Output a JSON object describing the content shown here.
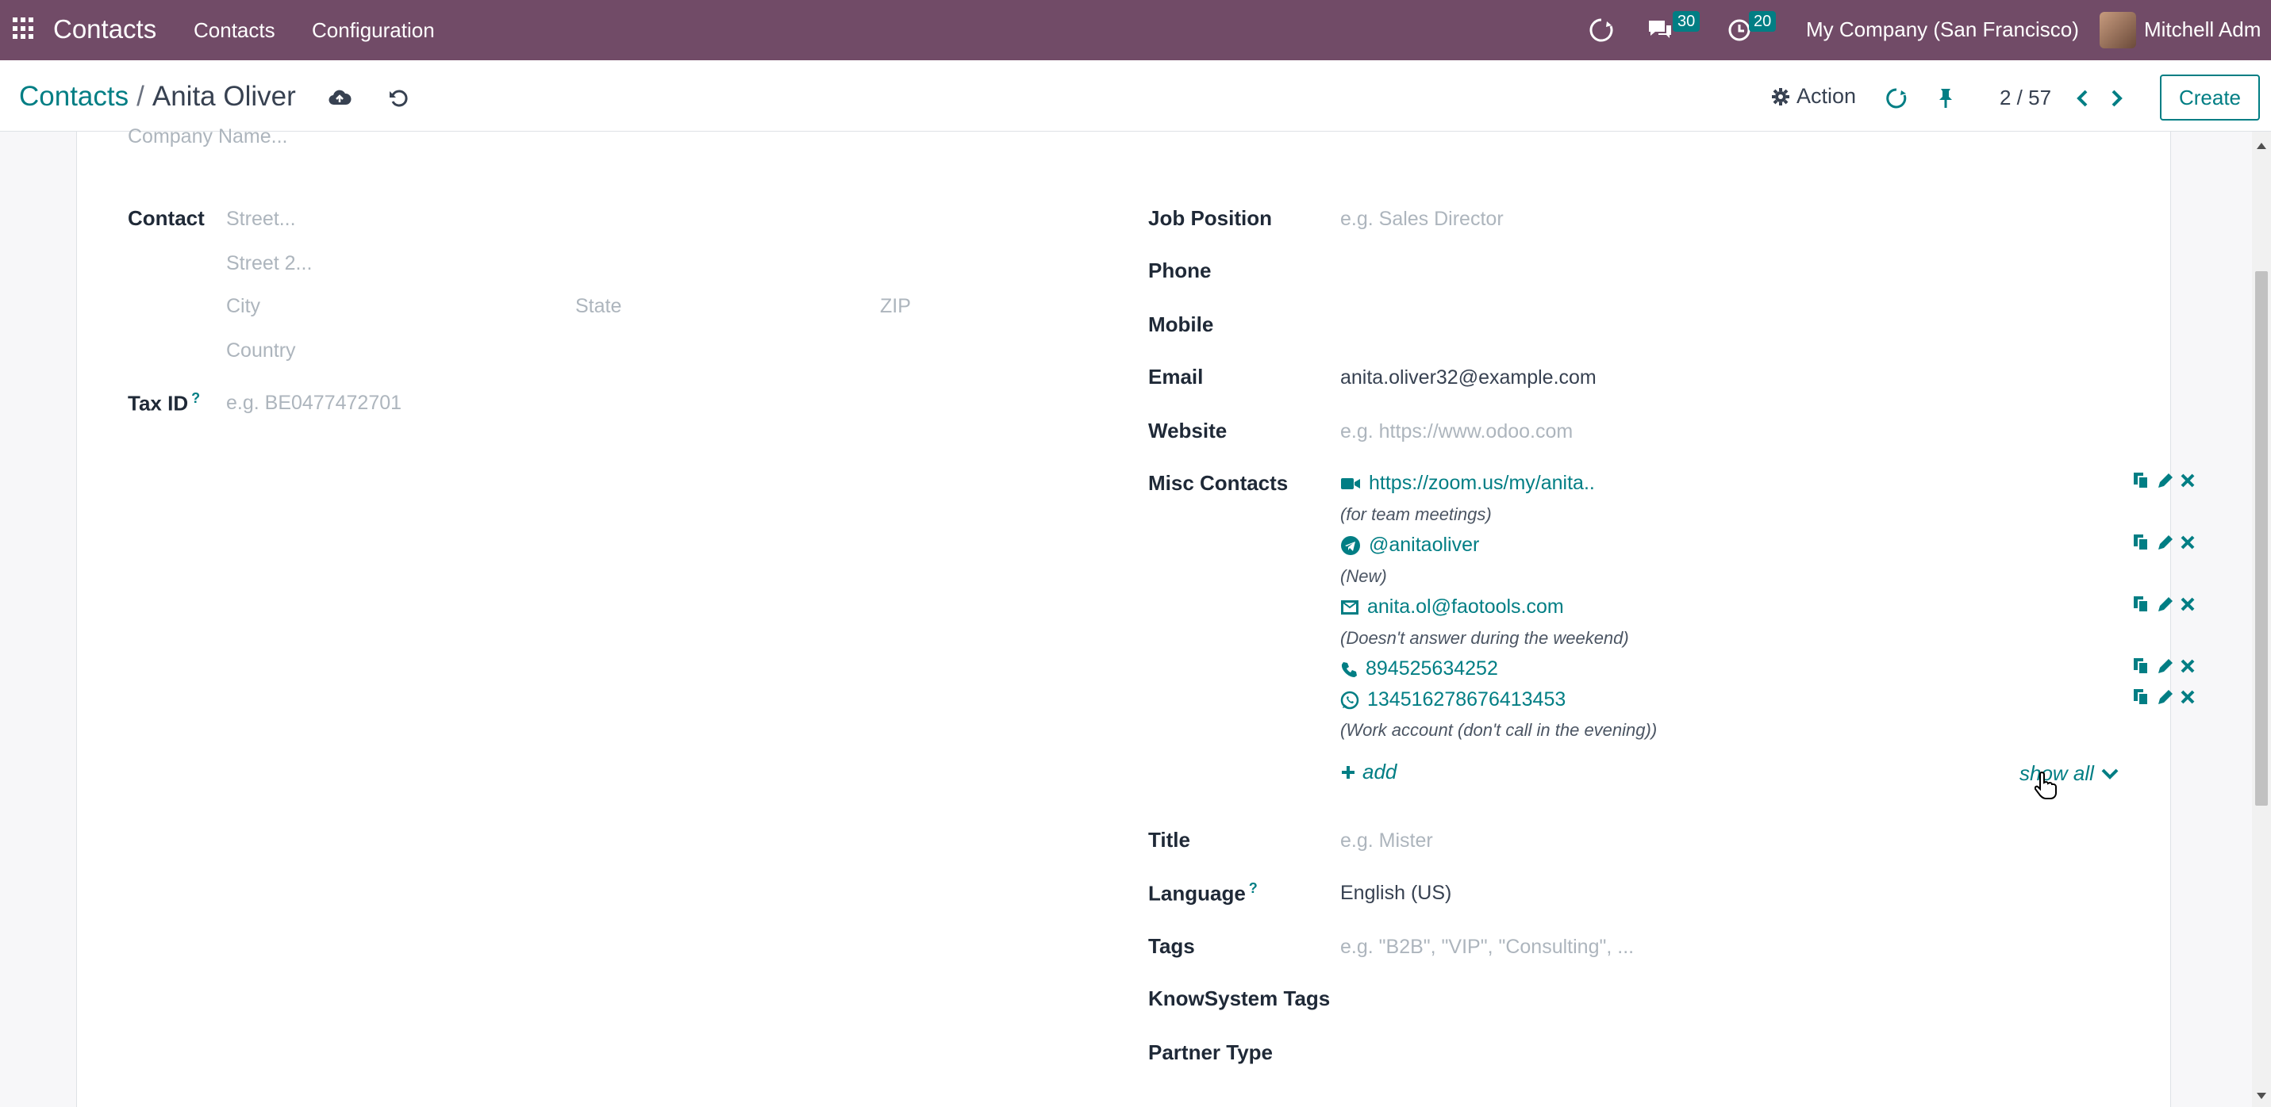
{
  "topbar": {
    "brand": "Contacts",
    "nav": [
      "Contacts",
      "Configuration"
    ],
    "messages_count": "30",
    "activities_count": "20",
    "company": "My Company (San Francisco)",
    "user": "Mitchell Adm"
  },
  "control": {
    "breadcrumb_parent": "Contacts",
    "breadcrumb_sep": "/",
    "record_name": "Anita Oliver",
    "action_label": "Action",
    "pager": "2 / 57",
    "create_label": "Create"
  },
  "form": {
    "company_name_placeholder": "Company Name...",
    "contact_label": "Contact",
    "street_placeholder": "Street...",
    "street2_placeholder": "Street 2...",
    "city_placeholder": "City",
    "state_placeholder": "State",
    "zip_placeholder": "ZIP",
    "country_placeholder": "Country",
    "tax_id_label": "Tax ID",
    "tax_id_help": "?",
    "tax_id_placeholder": "e.g. BE0477472701",
    "job_position_label": "Job Position",
    "job_position_placeholder": "e.g. Sales Director",
    "phone_label": "Phone",
    "mobile_label": "Mobile",
    "email_label": "Email",
    "email_value": "anita.oliver32@example.com",
    "website_label": "Website",
    "website_placeholder": "e.g. https://www.odoo.com",
    "misc_contacts_label": "Misc Contacts",
    "misc_contacts": [
      {
        "icon": "video-icon",
        "value": "https://zoom.us/my/anita..",
        "note": "(for team meetings)"
      },
      {
        "icon": "telegram-icon",
        "value": "@anitaoliver",
        "note": "(New)"
      },
      {
        "icon": "envelope-icon",
        "value": "anita.ol@faotools.com",
        "note": "(Doesn't answer during the weekend)"
      },
      {
        "icon": "phone-icon",
        "value": "894525634252",
        "note": ""
      },
      {
        "icon": "whatsapp-icon",
        "value": "134516278676413453",
        "note": "(Work account (don't call in the evening))"
      }
    ],
    "add_label": "add",
    "show_all_label": "show all",
    "title_label": "Title",
    "title_placeholder": "e.g. Mister",
    "language_label": "Language",
    "language_help": "?",
    "language_value": "English (US)",
    "tags_label": "Tags",
    "tags_placeholder": "e.g. \"B2B\", \"VIP\", \"Consulting\", ...",
    "knowsystem_tags_label": "KnowSystem Tags",
    "partner_type_label": "Partner Type"
  },
  "colors": {
    "topbar": "#714b67",
    "accent": "#017e84"
  }
}
